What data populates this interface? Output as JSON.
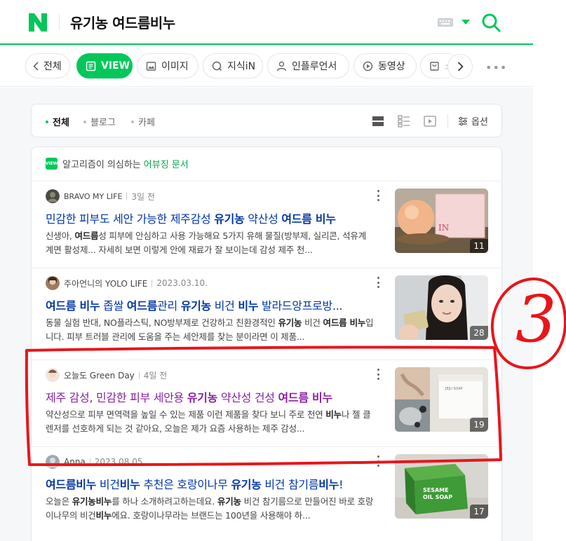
{
  "header": {
    "logo_letter": "N",
    "query": "유기농 여드름비누",
    "icons": [
      "naver-n-logo",
      "keyboard-icon",
      "dropdown-arrow-icon",
      "search-icon"
    ],
    "accent_color": "#03c75a"
  },
  "tabs": [
    {
      "label": "전체",
      "icon": "chevron-left-icon"
    },
    {
      "label": "VIEW",
      "icon": "view-doc-icon",
      "active": true
    },
    {
      "label": "이미지",
      "icon": "image-icon"
    },
    {
      "label": "지식iN",
      "icon": "qna-icon"
    },
    {
      "label": "인플루언서",
      "icon": "person-icon"
    },
    {
      "label": "동영상",
      "icon": "play-icon"
    },
    {
      "label": "쇼",
      "icon": "shopping-bag-icon"
    }
  ],
  "filters": {
    "items": [
      {
        "label": "전체",
        "active": true
      },
      {
        "label": "블로그",
        "active": false
      },
      {
        "label": "카페",
        "active": false
      }
    ],
    "options_label": "옵션"
  },
  "notice": {
    "badge": "VIEW",
    "text": "알고리즘이 의심하는",
    "link": "어뷰징 문서"
  },
  "results": [
    {
      "author": "BRAVO MY LIFE",
      "date": "3일 전",
      "title_parts": [
        {
          "t": "민감한 피부도 세안 가능한 제주감성 ",
          "b": false
        },
        {
          "t": "유기농",
          "b": true
        },
        {
          "t": " 약산성 ",
          "b": false
        },
        {
          "t": "여드름 비누",
          "b": true
        }
      ],
      "desc_parts": [
        {
          "t": "신생아, ",
          "b": false
        },
        {
          "t": "여드름",
          "b": true
        },
        {
          "t": "성 피부에 안심하고 사용 가능해요 5가지 유해 물질(방부제, 실리콘, 석유계 계면 활성제... 자세히 보면 이렇게 안에 재료가 잘 보이는데 감성 제주 천...",
          "b": false
        }
      ],
      "image_count": "11"
    },
    {
      "author": "주아언니의 YOLO LIFE",
      "date": "2023.03.10.",
      "title_parts": [
        {
          "t": "여드름 비누",
          "b": true
        },
        {
          "t": " 좁쌀 ",
          "b": false
        },
        {
          "t": "여드름",
          "b": true
        },
        {
          "t": "관리 ",
          "b": false
        },
        {
          "t": "유기농",
          "b": true
        },
        {
          "t": " 비건 ",
          "b": false
        },
        {
          "t": "비누",
          "b": true
        },
        {
          "t": " 발라드앙프로방...",
          "b": false
        }
      ],
      "desc_parts": [
        {
          "t": "동물 실험 반대, NO플라스틱, NO방부제로 건강하고 친환경적인 ",
          "b": false
        },
        {
          "t": "유기농",
          "b": true
        },
        {
          "t": " 비건 ",
          "b": false
        },
        {
          "t": "여드름 비누",
          "b": true
        },
        {
          "t": "입니다. 피부 트러블 관리에 도움을 주는 세안제를 찾는 분이라면 이 제품...",
          "b": false
        }
      ],
      "image_count": "28"
    },
    {
      "author": "오늘도 Green Day",
      "date": "4일 전",
      "visited": true,
      "title_parts": [
        {
          "t": "제주 감성, 민감한 피부 세안용 ",
          "b": false
        },
        {
          "t": "유기농",
          "b": true
        },
        {
          "t": " 약산성 건성 ",
          "b": false
        },
        {
          "t": "여드름 비누",
          "b": true
        }
      ],
      "desc_parts": [
        {
          "t": "약산성으로 피부 면역력을 높일 수 있는 제품 이런 제품을 찾다 보니 주로 천연 ",
          "b": false
        },
        {
          "t": "비누",
          "b": true
        },
        {
          "t": "나 젤 클렌저를 선호하게 되는 것 같아요, 오늘은 제가 요즘 사용하는 제주 감성...",
          "b": false
        }
      ],
      "image_count": "19"
    },
    {
      "author": "Anna",
      "date": "2023.08.05.",
      "title_parts": [
        {
          "t": "여드름비누",
          "b": true
        },
        {
          "t": " 비건",
          "b": false
        },
        {
          "t": "비누",
          "b": true
        },
        {
          "t": " 추천은 호랑이나무 ",
          "b": false
        },
        {
          "t": "유기농",
          "b": true
        },
        {
          "t": " 비건 참기름",
          "b": false
        },
        {
          "t": "비누",
          "b": true
        },
        {
          "t": "!",
          "b": false
        }
      ],
      "desc_parts": [
        {
          "t": "오늘은 ",
          "b": false
        },
        {
          "t": "유기농비누",
          "b": true
        },
        {
          "t": "를 하나 소개하려고하는데요. ",
          "b": false
        },
        {
          "t": "유기농",
          "b": true
        },
        {
          "t": " 비건 참기름으로 만들어진 바로 호랑이나무의 비건",
          "b": false
        },
        {
          "t": "비누",
          "b": true
        },
        {
          "t": "에요. 호랑이나무라는 브랜드는 100년을 사용해야 하...",
          "b": false
        }
      ],
      "image_count": "17"
    }
  ],
  "annotation": {
    "label": "3",
    "color": "#e8151b"
  }
}
